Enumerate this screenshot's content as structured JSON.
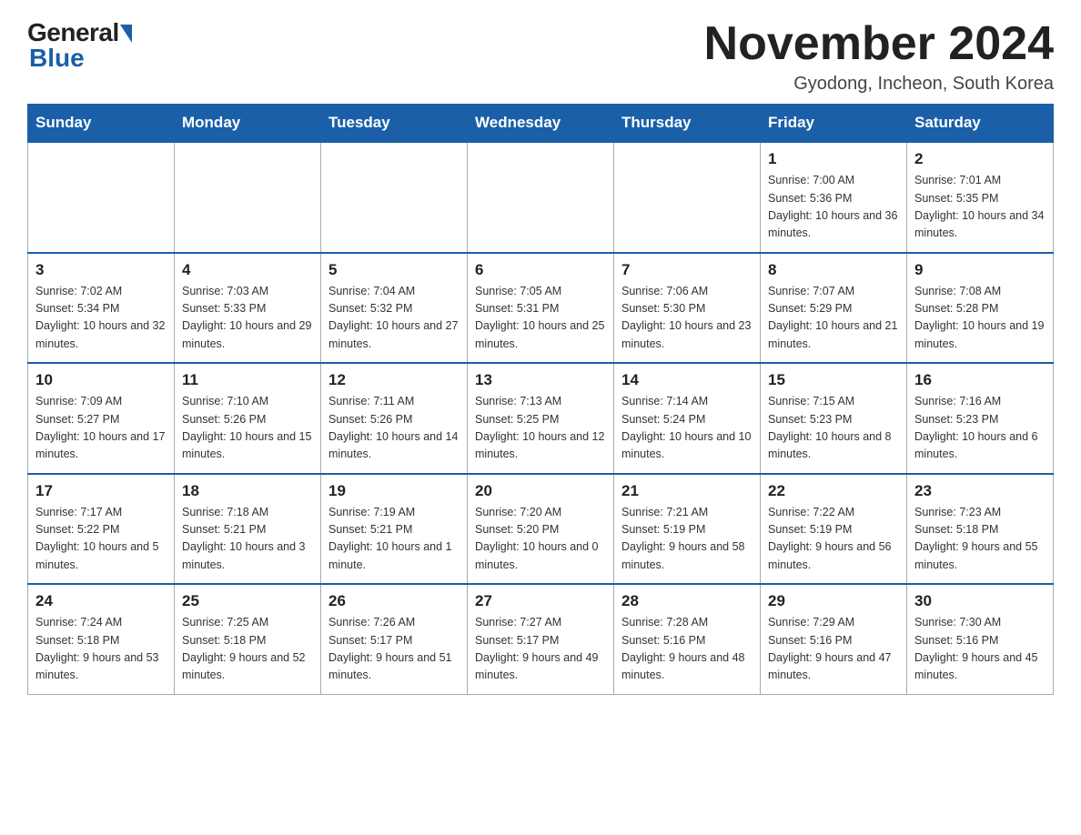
{
  "header": {
    "month_title": "November 2024",
    "location": "Gyodong, Incheon, South Korea"
  },
  "weekdays": [
    "Sunday",
    "Monday",
    "Tuesday",
    "Wednesday",
    "Thursday",
    "Friday",
    "Saturday"
  ],
  "weeks": [
    [
      {
        "day": "",
        "empty": true
      },
      {
        "day": "",
        "empty": true
      },
      {
        "day": "",
        "empty": true
      },
      {
        "day": "",
        "empty": true
      },
      {
        "day": "",
        "empty": true
      },
      {
        "day": "1",
        "sunrise": "7:00 AM",
        "sunset": "5:36 PM",
        "daylight": "10 hours and 36 minutes."
      },
      {
        "day": "2",
        "sunrise": "7:01 AM",
        "sunset": "5:35 PM",
        "daylight": "10 hours and 34 minutes."
      }
    ],
    [
      {
        "day": "3",
        "sunrise": "7:02 AM",
        "sunset": "5:34 PM",
        "daylight": "10 hours and 32 minutes."
      },
      {
        "day": "4",
        "sunrise": "7:03 AM",
        "sunset": "5:33 PM",
        "daylight": "10 hours and 29 minutes."
      },
      {
        "day": "5",
        "sunrise": "7:04 AM",
        "sunset": "5:32 PM",
        "daylight": "10 hours and 27 minutes."
      },
      {
        "day": "6",
        "sunrise": "7:05 AM",
        "sunset": "5:31 PM",
        "daylight": "10 hours and 25 minutes."
      },
      {
        "day": "7",
        "sunrise": "7:06 AM",
        "sunset": "5:30 PM",
        "daylight": "10 hours and 23 minutes."
      },
      {
        "day": "8",
        "sunrise": "7:07 AM",
        "sunset": "5:29 PM",
        "daylight": "10 hours and 21 minutes."
      },
      {
        "day": "9",
        "sunrise": "7:08 AM",
        "sunset": "5:28 PM",
        "daylight": "10 hours and 19 minutes."
      }
    ],
    [
      {
        "day": "10",
        "sunrise": "7:09 AM",
        "sunset": "5:27 PM",
        "daylight": "10 hours and 17 minutes."
      },
      {
        "day": "11",
        "sunrise": "7:10 AM",
        "sunset": "5:26 PM",
        "daylight": "10 hours and 15 minutes."
      },
      {
        "day": "12",
        "sunrise": "7:11 AM",
        "sunset": "5:26 PM",
        "daylight": "10 hours and 14 minutes."
      },
      {
        "day": "13",
        "sunrise": "7:13 AM",
        "sunset": "5:25 PM",
        "daylight": "10 hours and 12 minutes."
      },
      {
        "day": "14",
        "sunrise": "7:14 AM",
        "sunset": "5:24 PM",
        "daylight": "10 hours and 10 minutes."
      },
      {
        "day": "15",
        "sunrise": "7:15 AM",
        "sunset": "5:23 PM",
        "daylight": "10 hours and 8 minutes."
      },
      {
        "day": "16",
        "sunrise": "7:16 AM",
        "sunset": "5:23 PM",
        "daylight": "10 hours and 6 minutes."
      }
    ],
    [
      {
        "day": "17",
        "sunrise": "7:17 AM",
        "sunset": "5:22 PM",
        "daylight": "10 hours and 5 minutes."
      },
      {
        "day": "18",
        "sunrise": "7:18 AM",
        "sunset": "5:21 PM",
        "daylight": "10 hours and 3 minutes."
      },
      {
        "day": "19",
        "sunrise": "7:19 AM",
        "sunset": "5:21 PM",
        "daylight": "10 hours and 1 minute."
      },
      {
        "day": "20",
        "sunrise": "7:20 AM",
        "sunset": "5:20 PM",
        "daylight": "10 hours and 0 minutes."
      },
      {
        "day": "21",
        "sunrise": "7:21 AM",
        "sunset": "5:19 PM",
        "daylight": "9 hours and 58 minutes."
      },
      {
        "day": "22",
        "sunrise": "7:22 AM",
        "sunset": "5:19 PM",
        "daylight": "9 hours and 56 minutes."
      },
      {
        "day": "23",
        "sunrise": "7:23 AM",
        "sunset": "5:18 PM",
        "daylight": "9 hours and 55 minutes."
      }
    ],
    [
      {
        "day": "24",
        "sunrise": "7:24 AM",
        "sunset": "5:18 PM",
        "daylight": "9 hours and 53 minutes."
      },
      {
        "day": "25",
        "sunrise": "7:25 AM",
        "sunset": "5:18 PM",
        "daylight": "9 hours and 52 minutes."
      },
      {
        "day": "26",
        "sunrise": "7:26 AM",
        "sunset": "5:17 PM",
        "daylight": "9 hours and 51 minutes."
      },
      {
        "day": "27",
        "sunrise": "7:27 AM",
        "sunset": "5:17 PM",
        "daylight": "9 hours and 49 minutes."
      },
      {
        "day": "28",
        "sunrise": "7:28 AM",
        "sunset": "5:16 PM",
        "daylight": "9 hours and 48 minutes."
      },
      {
        "day": "29",
        "sunrise": "7:29 AM",
        "sunset": "5:16 PM",
        "daylight": "9 hours and 47 minutes."
      },
      {
        "day": "30",
        "sunrise": "7:30 AM",
        "sunset": "5:16 PM",
        "daylight": "9 hours and 45 minutes."
      }
    ]
  ],
  "labels": {
    "sunrise_prefix": "Sunrise: ",
    "sunset_prefix": "Sunset: ",
    "daylight_prefix": "Daylight: "
  }
}
